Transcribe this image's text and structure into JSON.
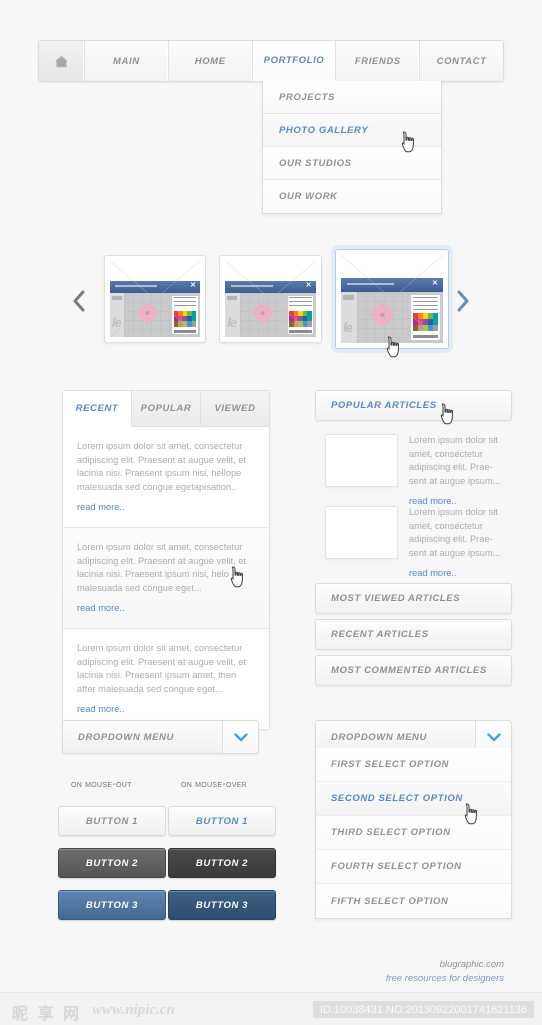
{
  "nav": {
    "home_icon": "home-icon",
    "items": [
      {
        "label": "MAIN",
        "state": "default"
      },
      {
        "label": "HOME",
        "state": "default"
      },
      {
        "label": "PORTFOLIO",
        "state": "active"
      },
      {
        "label": "FRIENDS",
        "state": "default"
      },
      {
        "label": "CONTACT",
        "state": "default"
      }
    ],
    "dropdown": [
      {
        "label": "PROJECTS",
        "state": "default"
      },
      {
        "label": "PHOTO GALLERY",
        "state": "hover"
      },
      {
        "label": "OUR STUDIOS",
        "state": "default"
      },
      {
        "label": "OUR WORK",
        "state": "default"
      }
    ]
  },
  "carousel": {
    "prev_icon": "chevron-left-icon",
    "next_icon": "chevron-right-icon",
    "slides": [
      {
        "selected": false
      },
      {
        "selected": false
      },
      {
        "selected": true
      }
    ]
  },
  "tabs_panel": {
    "tabs": [
      {
        "label": "RECENT",
        "state": "active"
      },
      {
        "label": "POPULAR",
        "state": "default"
      },
      {
        "label": "VIEWED",
        "state": "default"
      }
    ],
    "items": [
      {
        "text": "Lorem ipsum dolor sit amet, consectetur adipiscing elit. Praesent at augue velit, et lacinia nisi. Praesent ipsum nisi, hellope malesuada sed congue egetapisation..",
        "link": "read more.."
      },
      {
        "text": "Lorem ipsum dolor sit amet, consectetur adipiscing elit. Praesent at augue velit, et lacinia nisi. Praesent ipsum nisi, helo malesuada sed congue eget...",
        "link": "read more.."
      },
      {
        "text": "Lorem ipsum dolor sit amet, consectetur adipiscing elit. Praesent at augue velit, et lacinia nisi. Praesent ipsum amet, then after malesuada sed congue eget...",
        "link": "read more.."
      }
    ]
  },
  "sidebar": {
    "popular_header": "POPULAR ARTICLES",
    "articles": [
      {
        "text": "Lorem ipsum dolor sit amet, consectetur adipiscing elit. Prae-sent at augue ipsum...",
        "link": "read more.."
      },
      {
        "text": "Lorem ipsum dolor sit amet, consectetur adipiscing elit. Prae-sent at augue ipsum...",
        "link": "read more.."
      }
    ],
    "accordions": [
      {
        "label": "MOST VIEWED ARTICLES"
      },
      {
        "label": "RECENT ARTICLES"
      },
      {
        "label": "MOST COMMENTED ARTICLES"
      }
    ]
  },
  "select_left": {
    "value": "DROPDOWN MENU",
    "caret_icon": "chevron-down-icon"
  },
  "select_right": {
    "value": "DROPDOWN MENU",
    "caret_icon": "chevron-down-icon",
    "options": [
      {
        "label": "FIRST SELECT OPTION",
        "state": "default"
      },
      {
        "label": "SECOND SELECT OPTION",
        "state": "hover"
      },
      {
        "label": "THIRD SELECT OPTION",
        "state": "default"
      },
      {
        "label": "FOURTH SELECT OPTION",
        "state": "default"
      },
      {
        "label": "FIFTH SELECT OPTION",
        "state": "default"
      }
    ]
  },
  "buttons": {
    "col_out_label": "on mouse-out",
    "col_over_label": "on mouse-over",
    "rows": [
      {
        "label": "BUTTON 1",
        "style": "light"
      },
      {
        "label": "BUTTON 2",
        "style": "dark"
      },
      {
        "label": "BUTTON 3",
        "style": "blue"
      }
    ]
  },
  "footer": {
    "line1": "blugraphic.com",
    "line2": "free resources for designers"
  },
  "watermark": {
    "logo": "昵 享 网",
    "site": "www.nipic.cn",
    "id": "ID:10038431 NO:20130922001741621136"
  },
  "colors": {
    "accent_blue": "#5b87c4",
    "muted_text": "#8d9198",
    "body_text": "#a9adb3",
    "page_bg": "#f7f7f7",
    "button_dark": "#555555",
    "button_blue": "#45688f"
  }
}
